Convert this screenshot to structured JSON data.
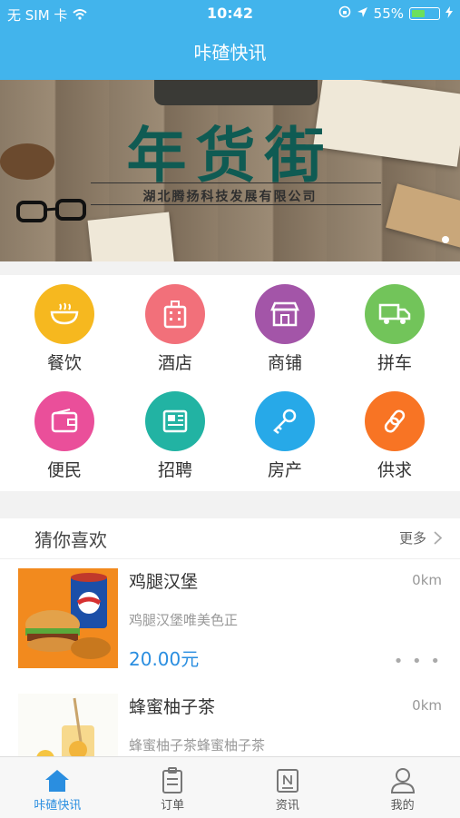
{
  "status": {
    "carrier": "无 SIM 卡",
    "time": "10:42",
    "battery": "55%",
    "battery_level": 0.55
  },
  "nav": {
    "title": "咔碴快讯"
  },
  "banner": {
    "headline": "年货街",
    "subtitle": "湖北腾扬科技发展有限公司"
  },
  "categories": [
    {
      "label": "餐饮",
      "color": "#f6b81f",
      "icon": "bowl-icon"
    },
    {
      "label": "酒店",
      "color": "#f2707a",
      "icon": "building-icon"
    },
    {
      "label": "商铺",
      "color": "#a355a8",
      "icon": "shop-icon"
    },
    {
      "label": "拼车",
      "color": "#72c45a",
      "icon": "truck-icon"
    },
    {
      "label": "便民",
      "color": "#ea4f9a",
      "icon": "wallet-icon"
    },
    {
      "label": "招聘",
      "color": "#22b3a3",
      "icon": "newspaper-icon"
    },
    {
      "label": "房产",
      "color": "#27a9e8",
      "icon": "key-icon"
    },
    {
      "label": "供求",
      "color": "#f87424",
      "icon": "link-icon"
    }
  ],
  "recommend": {
    "title": "猜你喜欢",
    "more": "更多",
    "items": [
      {
        "name": "鸡腿汉堡",
        "distance": "0km",
        "desc": "鸡腿汉堡唯美色正",
        "price": "20.00元"
      },
      {
        "name": "蜂蜜柚子茶",
        "distance": "0km",
        "desc": "蜂蜜柚子茶蜂蜜柚子茶"
      }
    ]
  },
  "tabs": [
    {
      "label": "咔碴快讯",
      "icon": "home-icon",
      "active": true
    },
    {
      "label": "订单",
      "icon": "clipboard-icon"
    },
    {
      "label": "资讯",
      "icon": "news-icon"
    },
    {
      "label": "我的",
      "icon": "user-icon"
    }
  ]
}
